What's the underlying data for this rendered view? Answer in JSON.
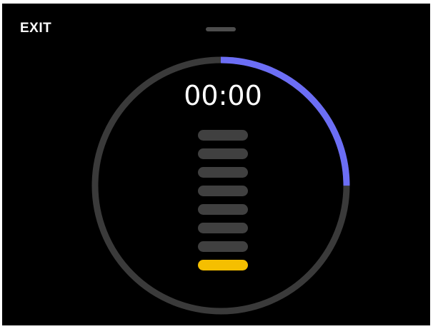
{
  "header": {
    "exit_label": "EXIT"
  },
  "timer": {
    "display": "00:00",
    "progress": 0.25,
    "progress_color": "#6c6ef5",
    "track_color": "#3a3a3a"
  },
  "levels": {
    "count": 8,
    "active_index": 7,
    "inactive_color": "#404040",
    "active_color": "#f5bf00"
  }
}
